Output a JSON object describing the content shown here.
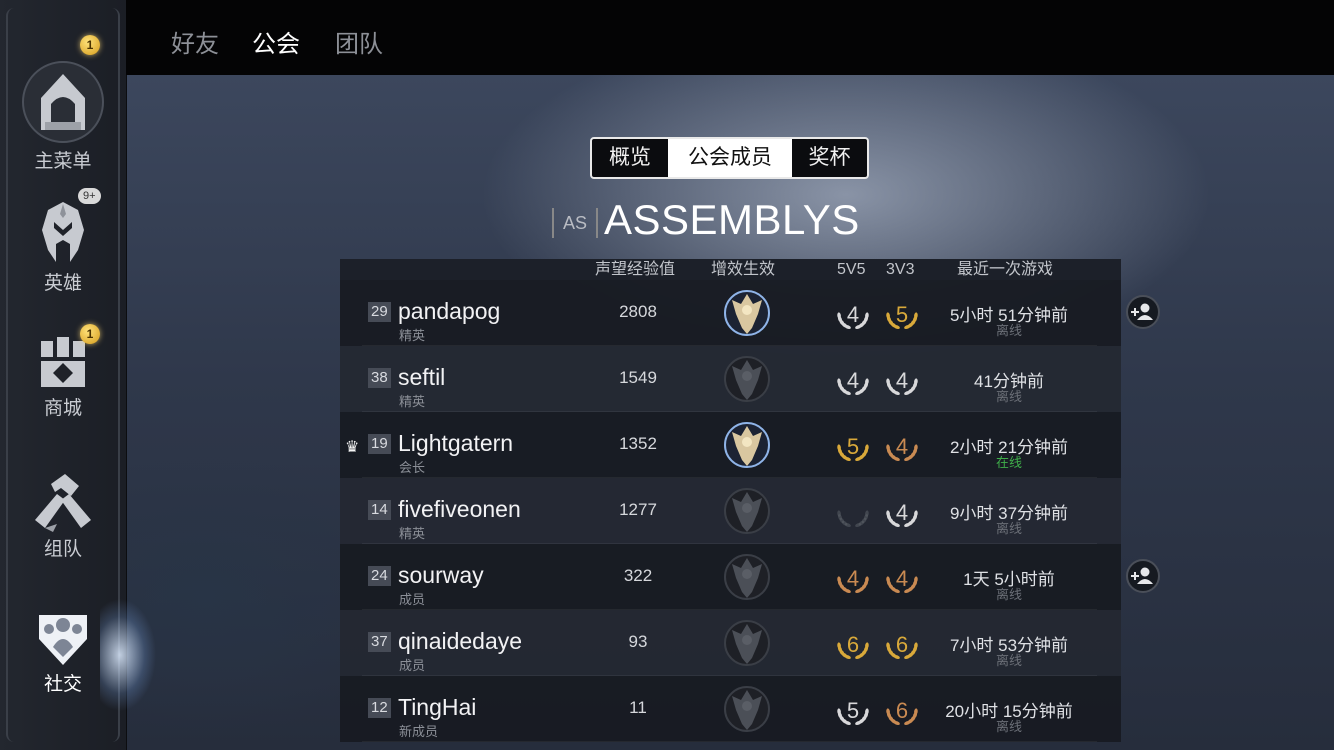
{
  "sidebar": {
    "items": [
      {
        "label": "主菜单",
        "icon": "main-menu-icon",
        "badge": "1"
      },
      {
        "label": "英雄",
        "icon": "hero-helmet-icon",
        "badge": "9+"
      },
      {
        "label": "商城",
        "icon": "shop-icon",
        "badge": "1"
      },
      {
        "label": "组队",
        "icon": "team-handshake-icon",
        "badge": ""
      },
      {
        "label": "社交",
        "icon": "social-icon",
        "badge": ""
      }
    ]
  },
  "topbar": {
    "tabs": [
      {
        "label": "好友"
      },
      {
        "label": "公会"
      },
      {
        "label": "团队"
      }
    ]
  },
  "guild_tabs": [
    {
      "label": "概览"
    },
    {
      "label": "公会成员"
    },
    {
      "label": "奖杯"
    }
  ],
  "guild": {
    "tag": "AS",
    "name": "ASSEMBLYS"
  },
  "table": {
    "headers": {
      "reputation": "声望经验值",
      "buff": "增效生效",
      "mode5": "5V5",
      "mode3": "3V3",
      "last_game": "最近一次游戏"
    },
    "rows": [
      {
        "level": "29",
        "name": "pandapog",
        "role": "精英",
        "reputation": "2808",
        "buff_active": true,
        "rank5v5": "4",
        "rank5v5_tier": "silver",
        "rank3v3": "5",
        "rank3v3_tier": "gold",
        "last_game": "5小时 51分钟前",
        "status": "离线",
        "online": false,
        "crown": false,
        "add_friend": true
      },
      {
        "level": "38",
        "name": "seftil",
        "role": "精英",
        "reputation": "1549",
        "buff_active": false,
        "rank5v5": "4",
        "rank5v5_tier": "silver",
        "rank3v3": "4",
        "rank3v3_tier": "silver",
        "last_game": "41分钟前",
        "status": "离线",
        "online": false,
        "crown": false,
        "add_friend": false
      },
      {
        "level": "19",
        "name": "Lightgatern",
        "role": "会长",
        "reputation": "1352",
        "buff_active": true,
        "rank5v5": "5",
        "rank5v5_tier": "gold",
        "rank3v3": "4",
        "rank3v3_tier": "bronze",
        "last_game": "2小时 21分钟前",
        "status": "在线",
        "online": true,
        "crown": true,
        "add_friend": false
      },
      {
        "level": "14",
        "name": "fivefiveonen",
        "role": "精英",
        "reputation": "1277",
        "buff_active": false,
        "rank5v5": "",
        "rank5v5_tier": "empty",
        "rank3v3": "4",
        "rank3v3_tier": "silver",
        "last_game": "9小时 37分钟前",
        "status": "离线",
        "online": false,
        "crown": false,
        "add_friend": false
      },
      {
        "level": "24",
        "name": "sourway",
        "role": "成员",
        "reputation": "322",
        "buff_active": false,
        "rank5v5": "4",
        "rank5v5_tier": "bronze",
        "rank3v3": "4",
        "rank3v3_tier": "bronze",
        "last_game": "1天 5小时前",
        "status": "离线",
        "online": false,
        "crown": false,
        "add_friend": true
      },
      {
        "level": "37",
        "name": "qinaidedaye",
        "role": "成员",
        "reputation": "93",
        "buff_active": false,
        "rank5v5": "6",
        "rank5v5_tier": "gold",
        "rank3v3": "6",
        "rank3v3_tier": "gold",
        "last_game": "7小时 53分钟前",
        "status": "离线",
        "online": false,
        "crown": false,
        "add_friend": false
      },
      {
        "level": "12",
        "name": "TingHai",
        "role": "新成员",
        "reputation": "11",
        "buff_active": false,
        "rank5v5": "5",
        "rank5v5_tier": "silver",
        "rank3v3": "6",
        "rank3v3_tier": "bronze",
        "last_game": "20小时 15分钟前",
        "status": "离线",
        "online": false,
        "crown": false,
        "add_friend": false
      }
    ]
  },
  "colors": {
    "gold": "#d9a93a",
    "silver": "#d8d8da",
    "bronze": "#c98a52",
    "online": "#3fae4a"
  }
}
